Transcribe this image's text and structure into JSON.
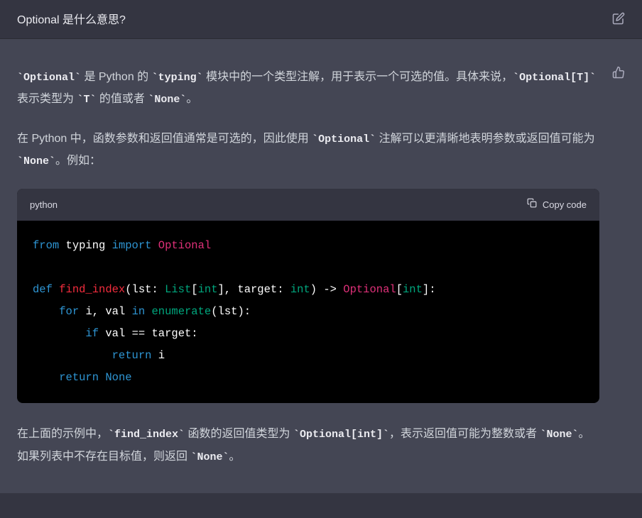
{
  "user": {
    "question": "Optional 是什么意思?"
  },
  "assistant": {
    "p1_a": "`Optional`",
    "p1_b": " 是 Python 的 ",
    "p1_c": "`typing`",
    "p1_d": " 模块中的一个类型注解，用于表示一个可选的值。具体来说，",
    "p1_e": "`Optional[T]`",
    "p1_f": " 表示类型为 ",
    "p1_g": "`T`",
    "p1_h": " 的值或者 ",
    "p1_i": "`None`",
    "p1_j": "。",
    "p2_a": "在 Python 中，函数参数和返回值通常是可选的，因此使用 ",
    "p2_b": "`Optional`",
    "p2_c": " 注解可以更清晰地表明参数或返回值可能为 ",
    "p2_d": "`None`",
    "p2_e": "。例如：",
    "p3_a": "在上面的示例中，",
    "p3_b": "`find_index`",
    "p3_c": " 函数的返回值类型为 ",
    "p3_d": "`Optional[int]`",
    "p3_e": "，表示返回值可能为整数或者 ",
    "p3_f": "`None`",
    "p3_g": "。如果列表中不存在目标值，则返回 ",
    "p3_h": "`None`",
    "p3_i": "。"
  },
  "codeblock": {
    "lang": "python",
    "copy_label": "Copy code",
    "tokens": {
      "from": "from",
      "typing": "typing",
      "import": "import",
      "Optional": "Optional",
      "def": "def",
      "find_index": "find_index",
      "lst": "lst",
      "List": "List",
      "int": "int",
      "target": "target",
      "arrow": "->",
      "for": "for",
      "i": "i",
      "val": "val",
      "in": "in",
      "enumerate": "enumerate",
      "if": "if",
      "eq": "==",
      "return": "return",
      "None": "None"
    }
  }
}
